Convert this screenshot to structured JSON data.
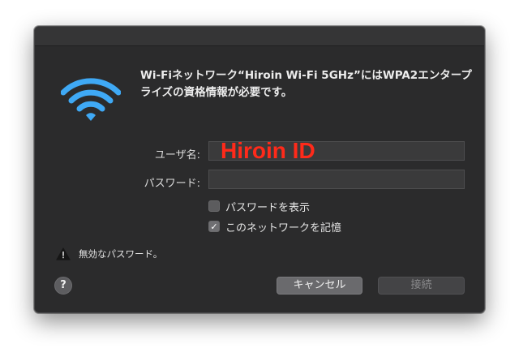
{
  "dialog": {
    "message": "Wi-Fiネットワーク“Hiroin Wi-Fi 5GHz”にはWPA2エンタープライズの資格情報が必要です。",
    "username_label": "ユーザ名:",
    "username_value": "Hiroin ID",
    "password_label": "パスワード:",
    "password_value": "",
    "show_password_label": "パスワードを表示",
    "show_password_checked": false,
    "remember_network_label": "このネットワークを記憶",
    "remember_network_checked": true,
    "checkmark": "✓",
    "warning_text": "無効なパスワード。",
    "help_label": "?",
    "cancel_label": "キャンセル",
    "connect_label": "接続"
  },
  "icons": {
    "wifi": "wifi-icon",
    "warning": "warning-triangle-icon",
    "help": "help-icon"
  },
  "colors": {
    "dialog_bg": "#2b2b2c",
    "wifi_blue": "#3fa9f5",
    "username_text": "#ff2a1a",
    "text": "#ececec"
  }
}
